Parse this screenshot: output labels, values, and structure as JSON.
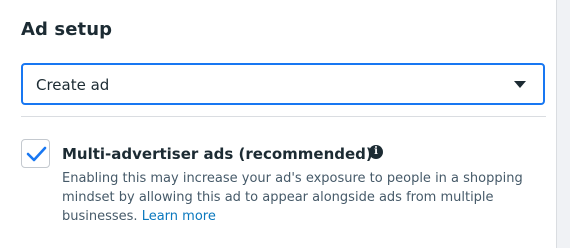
{
  "section": {
    "title": "Ad setup"
  },
  "select": {
    "value": "Create ad",
    "caret_icon": "caret-down-icon"
  },
  "option": {
    "checked": true,
    "title": "Multi-advertiser ads (recommended)",
    "info_icon": "info-icon",
    "description": "Enabling this may increase your ad's exposure to people in a shopping mindset by allowing this ad to appear alongside ads from multiple businesses.",
    "link": "Learn more"
  },
  "colors": {
    "accent": "#1877f2",
    "text": "#1c2b33",
    "muted": "#465a69",
    "link": "#0a78be"
  }
}
